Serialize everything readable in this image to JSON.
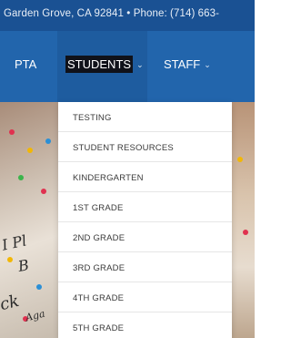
{
  "topbar": {
    "text": "Garden Grove, CA 92841  •  Phone: (714) 663-"
  },
  "nav": {
    "pta": "PTA",
    "students": "STUDENTS",
    "staff": "STAFF",
    "chevron": "⌄"
  },
  "dropdown": {
    "items": [
      {
        "label": "TESTING"
      },
      {
        "label": "STUDENT RESOURCES"
      },
      {
        "label": "KINDERGARTEN"
      },
      {
        "label": "1ST GRADE"
      },
      {
        "label": "2ND GRADE"
      },
      {
        "label": "3RD GRADE"
      },
      {
        "label": "4TH GRADE"
      },
      {
        "label": "5TH GRADE"
      }
    ]
  },
  "colors": {
    "topbar": "#1a5193",
    "navbar": "#2265ac",
    "active": "#1e5c9f"
  }
}
